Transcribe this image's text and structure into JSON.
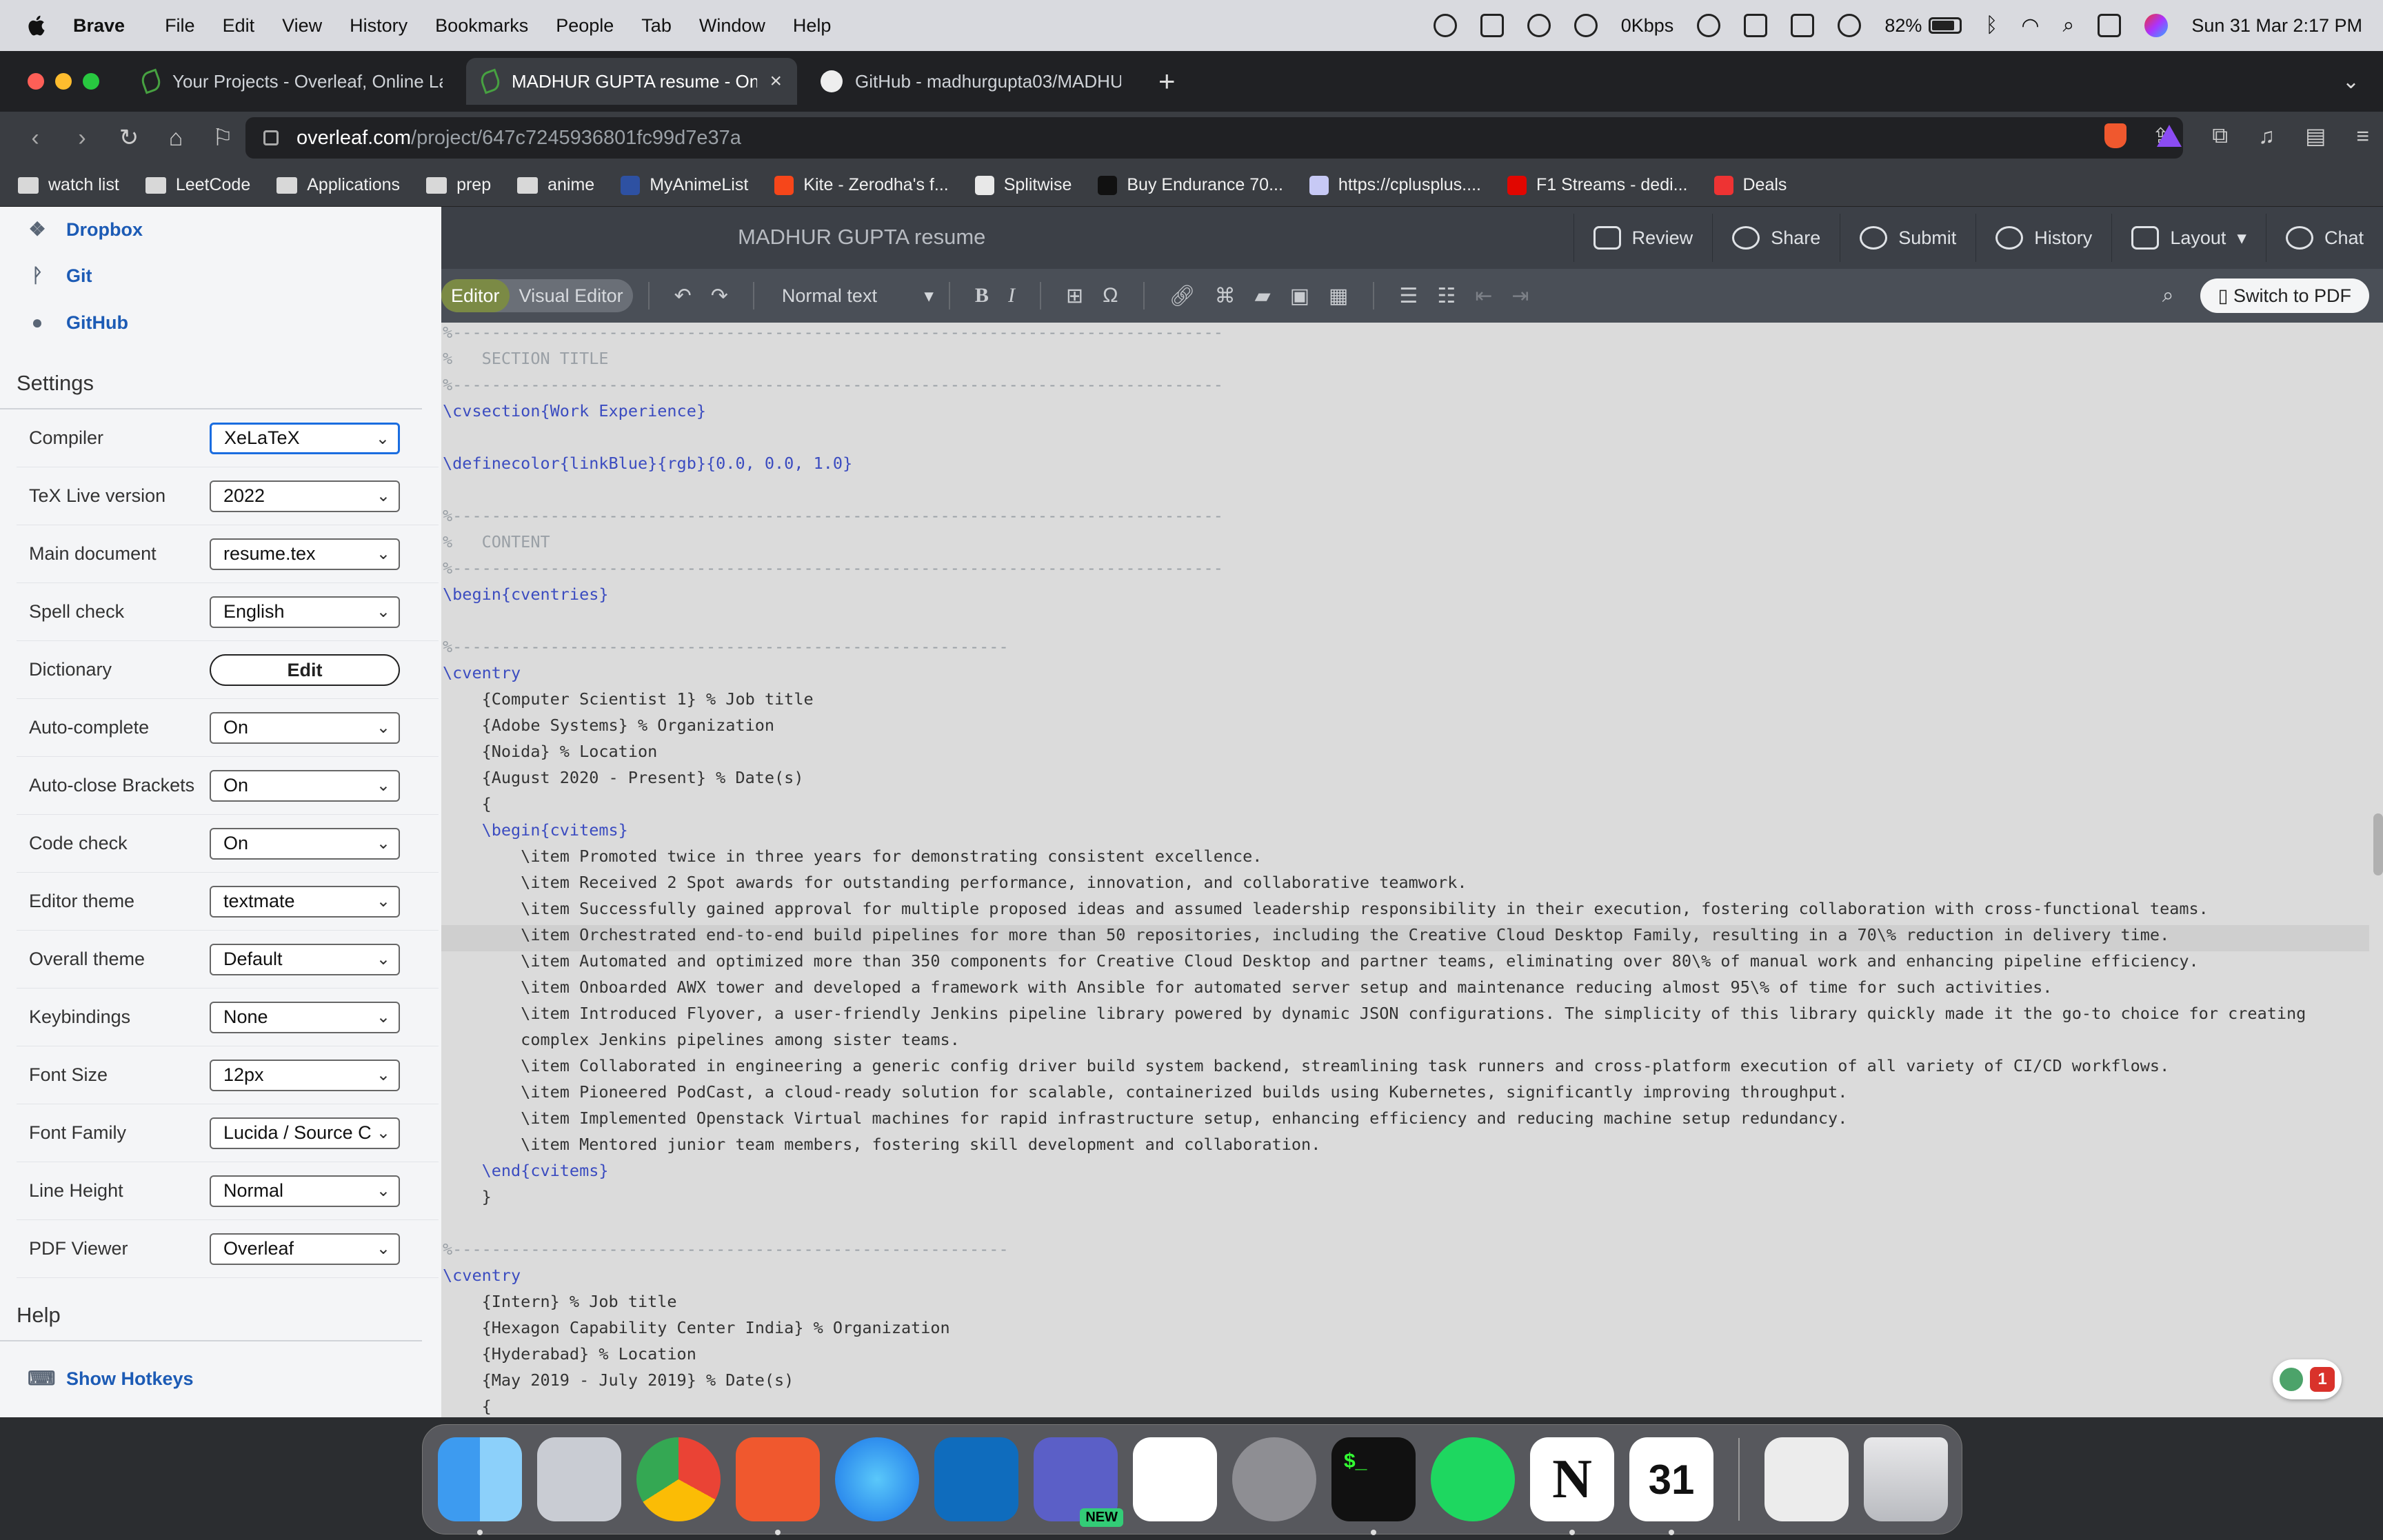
{
  "menubar": {
    "app": "Brave",
    "items": [
      "File",
      "Edit",
      "View",
      "History",
      "Bookmarks",
      "People",
      "Tab",
      "Window",
      "Help"
    ],
    "net_speed": "0Kbps",
    "battery": "82%",
    "datetime": "Sun 31 Mar  2:17 PM"
  },
  "tabs": [
    {
      "title": "Your Projects - Overleaf, Online La",
      "active": false
    },
    {
      "title": "MADHUR GUPTA resume - On",
      "active": true
    },
    {
      "title": "GitHub - madhurgupta03/MADHUR",
      "active": false
    }
  ],
  "address": {
    "host": "overleaf.com",
    "path": "/project/647c7245936801fc99d7e37a"
  },
  "bookmarks": [
    "watch list",
    "LeetCode",
    "Applications",
    "prep",
    "anime",
    "MyAnimeList",
    "Kite - Zerodha's f...",
    "Splitwise",
    "Buy Endurance 70...",
    "https://cplusplus....",
    "F1 Streams - dedi...",
    "Deals"
  ],
  "sidebar": {
    "links": [
      "Dropbox",
      "Git",
      "GitHub"
    ],
    "settings_title": "Settings",
    "settings": [
      {
        "label": "Compiler",
        "value": "XeLaTeX"
      },
      {
        "label": "TeX Live version",
        "value": "2022"
      },
      {
        "label": "Main document",
        "value": "resume.tex"
      },
      {
        "label": "Spell check",
        "value": "English"
      },
      {
        "label": "Dictionary",
        "value": "Edit"
      },
      {
        "label": "Auto-complete",
        "value": "On"
      },
      {
        "label": "Auto-close Brackets",
        "value": "On"
      },
      {
        "label": "Code check",
        "value": "On"
      },
      {
        "label": "Editor theme",
        "value": "textmate"
      },
      {
        "label": "Overall theme",
        "value": "Default"
      },
      {
        "label": "Keybindings",
        "value": "None"
      },
      {
        "label": "Font Size",
        "value": "12px"
      },
      {
        "label": "Font Family",
        "value": "Lucida / Source C"
      },
      {
        "label": "Line Height",
        "value": "Normal"
      },
      {
        "label": "PDF Viewer",
        "value": "Overleaf"
      }
    ],
    "help_title": "Help",
    "show_hotkeys": "Show Hotkeys"
  },
  "editor": {
    "project_title": "MADHUR GUPTA resume",
    "actions": [
      "Review",
      "Share",
      "Submit",
      "History",
      "Layout",
      "Chat"
    ],
    "mode_source": "Editor",
    "mode_visual": "Visual Editor",
    "text_style": "Normal text",
    "switch_pdf": "Switch to PDF",
    "notif_count": "1"
  },
  "code_lines": [
    "%-------------------------------------------------------------------------------",
    "%   SECTION TITLE",
    "%-------------------------------------------------------------------------------",
    "\\cvsection{Work Experience}",
    "",
    "\\definecolor{linkBlue}{rgb}{0.0, 0.0, 1.0}",
    "",
    "%-------------------------------------------------------------------------------",
    "%   CONTENT",
    "%-------------------------------------------------------------------------------",
    "\\begin{cventries}",
    "",
    "%---------------------------------------------------------",
    "\\cventry",
    "    {Computer Scientist 1} % Job title",
    "    {Adobe Systems} % Organization",
    "    {Noida} % Location",
    "    {August 2020 - Present} % Date(s)",
    "    {",
    "    \\begin{cvitems}",
    "        \\item Promoted twice in three years for demonstrating consistent excellence.",
    "        \\item Received 2 Spot awards for outstanding performance, innovation, and collaborative teamwork.",
    "        \\item Successfully gained approval for multiple proposed ideas and assumed leadership responsibility in their execution, fostering collaboration with cross-functional teams.",
    "        \\item Orchestrated end-to-end build pipelines for more than 50 repositories, including the Creative Cloud Desktop Family, resulting in a 70\\% reduction in delivery time.",
    "        \\item Automated and optimized more than 350 components for Creative Cloud Desktop and partner teams, eliminating over 80\\% of manual work and enhancing pipeline efficiency.",
    "        \\item Onboarded AWX tower and developed a framework with Ansible for automated server setup and maintenance reducing almost 95\\% of time for such activities.",
    "        \\item Introduced Flyover, a user-friendly Jenkins pipeline library powered by dynamic JSON configurations. The simplicity of this library quickly made it the go-to choice for creating",
    "        complex Jenkins pipelines among sister teams.",
    "        \\item Collaborated in engineering a generic config driver build system backend, streamlining task runners and cross-platform execution of all variety of CI/CD workflows.",
    "        \\item Pioneered PodCast, a cloud-ready solution for scalable, containerized builds using Kubernetes, significantly improving throughput.",
    "        \\item Implemented Openstack Virtual machines for rapid infrastructure setup, enhancing efficiency and reducing machine setup redundancy.",
    "        \\item Mentored junior team members, fostering skill development and collaboration.",
    "    \\end{cvitems}",
    "    }",
    "",
    "%---------------------------------------------------------",
    "\\cventry",
    "    {Intern} % Job title",
    "    {Hexagon Capability Center India} % Organization",
    "    {Hyderabad} % Location",
    "    {May 2019 - July 2019} % Date(s)",
    "    {"
  ],
  "dock": [
    "Finder",
    "Launchpad",
    "Chrome",
    "Brave",
    "Safari",
    "Outlook",
    "Teams",
    "Slack",
    "System Settings",
    "Terminal",
    "Spotify",
    "Notion",
    "Notion Calendar",
    "Documents",
    "Trash"
  ],
  "dock_new_badge": "NEW",
  "dock_calendar_date": "31",
  "colors": {
    "accent": "#1c5bb5",
    "editor_bg": "#dbdbdb",
    "toolbar": "#3c4047",
    "overleaf_green": "#7b8a45"
  }
}
